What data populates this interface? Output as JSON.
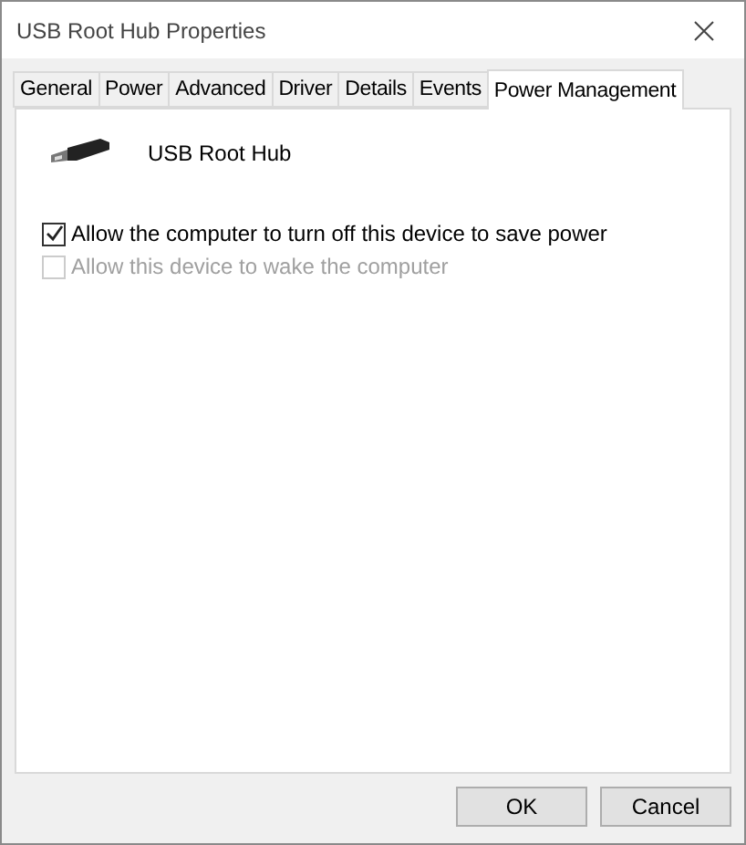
{
  "window": {
    "title": "USB Root Hub Properties"
  },
  "tabs": [
    {
      "label": "General",
      "selected": false
    },
    {
      "label": "Power",
      "selected": false
    },
    {
      "label": "Advanced",
      "selected": false
    },
    {
      "label": "Driver",
      "selected": false
    },
    {
      "label": "Details",
      "selected": false
    },
    {
      "label": "Events",
      "selected": false
    },
    {
      "label": "Power Management",
      "selected": true
    }
  ],
  "device": {
    "name": "USB Root Hub"
  },
  "options": [
    {
      "label": "Allow the computer to turn off this device to save power",
      "checked": true,
      "disabled": false
    },
    {
      "label": "Allow this device to wake the computer",
      "checked": false,
      "disabled": true
    }
  ],
  "buttons": [
    "OK",
    "Cancel"
  ]
}
